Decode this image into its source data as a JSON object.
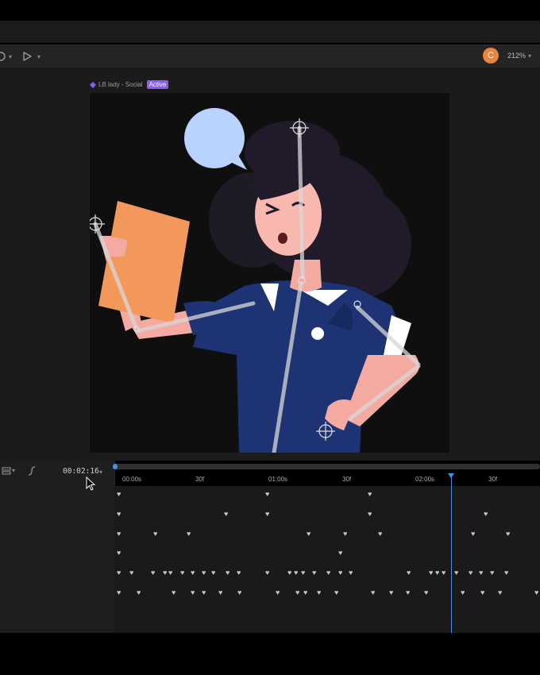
{
  "toolbar": {
    "avatar_initial": "C",
    "zoom": "212%",
    "icons": [
      "record-icon",
      "play-icon"
    ]
  },
  "artboard": {
    "name": "LB lady - Social",
    "badge": "Active"
  },
  "timeline": {
    "current_time": "00:02:16",
    "ruler": [
      "00:00s",
      "30f",
      "01:00s",
      "30f",
      "02:00s",
      "30f"
    ],
    "tracks": [
      [
        150,
        337,
        466
      ],
      [
        150,
        285,
        337,
        466,
        612
      ],
      [
        150,
        196,
        238,
        389,
        435,
        479,
        596,
        640
      ],
      [
        150,
        429
      ],
      [
        150,
        166,
        193,
        208,
        215,
        230,
        243,
        257,
        269,
        287,
        301,
        337,
        365,
        373,
        382,
        396,
        414,
        429,
        442,
        515,
        543,
        551,
        559,
        575,
        593,
        606,
        620,
        638
      ],
      [
        150,
        175,
        219,
        243,
        257,
        278,
        302,
        350,
        375,
        385,
        402,
        424,
        470,
        493,
        514,
        537,
        583,
        608,
        630,
        676
      ]
    ]
  }
}
